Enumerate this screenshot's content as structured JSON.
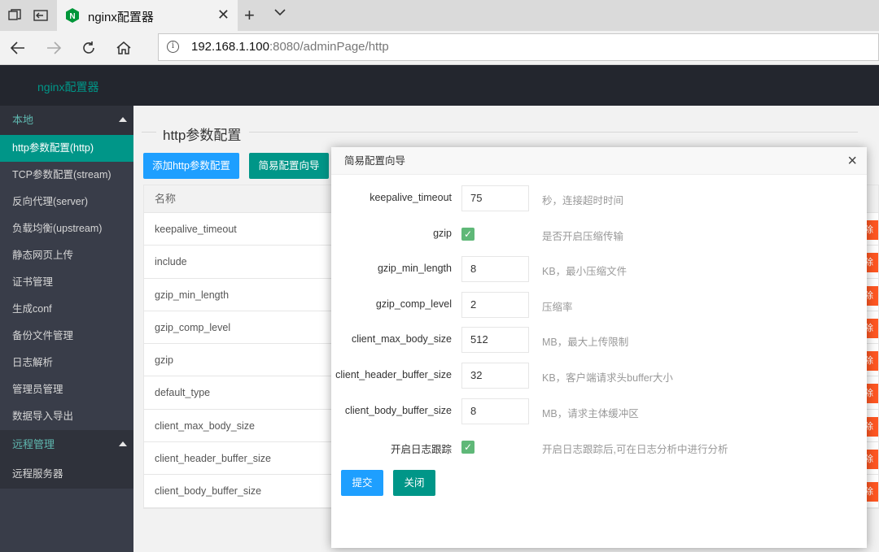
{
  "browser": {
    "tab_title": "nginx配置器",
    "favicon_letter": "N",
    "url_host": "192.168.1.100",
    "url_rest": ":8080/adminPage/http"
  },
  "app": {
    "title": "nginx配置器"
  },
  "sidebar": {
    "group_local": "本地",
    "items": [
      "http参数配置(http)",
      "TCP参数配置(stream)",
      "反向代理(server)",
      "负载均衡(upstream)",
      "静态网页上传",
      "证书管理",
      "生成conf",
      "备份文件管理",
      "日志解析",
      "管理员管理",
      "数据导入导出"
    ],
    "group_remote": "远程管理",
    "remote_items": [
      "远程服务器"
    ]
  },
  "main": {
    "page_title": "http参数配置",
    "add_button": "添加http参数配置",
    "wizard_button": "简易配置向导",
    "table_header": "名称",
    "rows": [
      "keepalive_timeout",
      "include",
      "gzip_min_length",
      "gzip_comp_level",
      "gzip",
      "default_type",
      "client_max_body_size",
      "client_header_buffer_size",
      "client_body_buffer_size"
    ],
    "delete_label": "除"
  },
  "modal": {
    "title": "简易配置向导",
    "fields": [
      {
        "label": "keepalive_timeout",
        "type": "input",
        "value": "75",
        "hint": "秒，连接超时时间"
      },
      {
        "label": "gzip",
        "type": "check",
        "hint": "是否开启压缩传输"
      },
      {
        "label": "gzip_min_length",
        "type": "input",
        "value": "8",
        "hint": "KB，最小压缩文件"
      },
      {
        "label": "gzip_comp_level",
        "type": "input",
        "value": "2",
        "hint": "压缩率"
      },
      {
        "label": "client_max_body_size",
        "type": "input",
        "value": "512",
        "hint": "MB，最大上传限制"
      },
      {
        "label": "client_header_buffer_size",
        "type": "input",
        "value": "32",
        "hint": "KB，客户端请求头buffer大小"
      },
      {
        "label": "client_body_buffer_size",
        "type": "input",
        "value": "8",
        "hint": "MB，请求主体缓冲区"
      },
      {
        "label": "开启日志跟踪",
        "type": "check",
        "hint": "开启日志跟踪后,可在日志分析中进行分析"
      }
    ],
    "submit_label": "提交",
    "close_label": "关闭"
  }
}
